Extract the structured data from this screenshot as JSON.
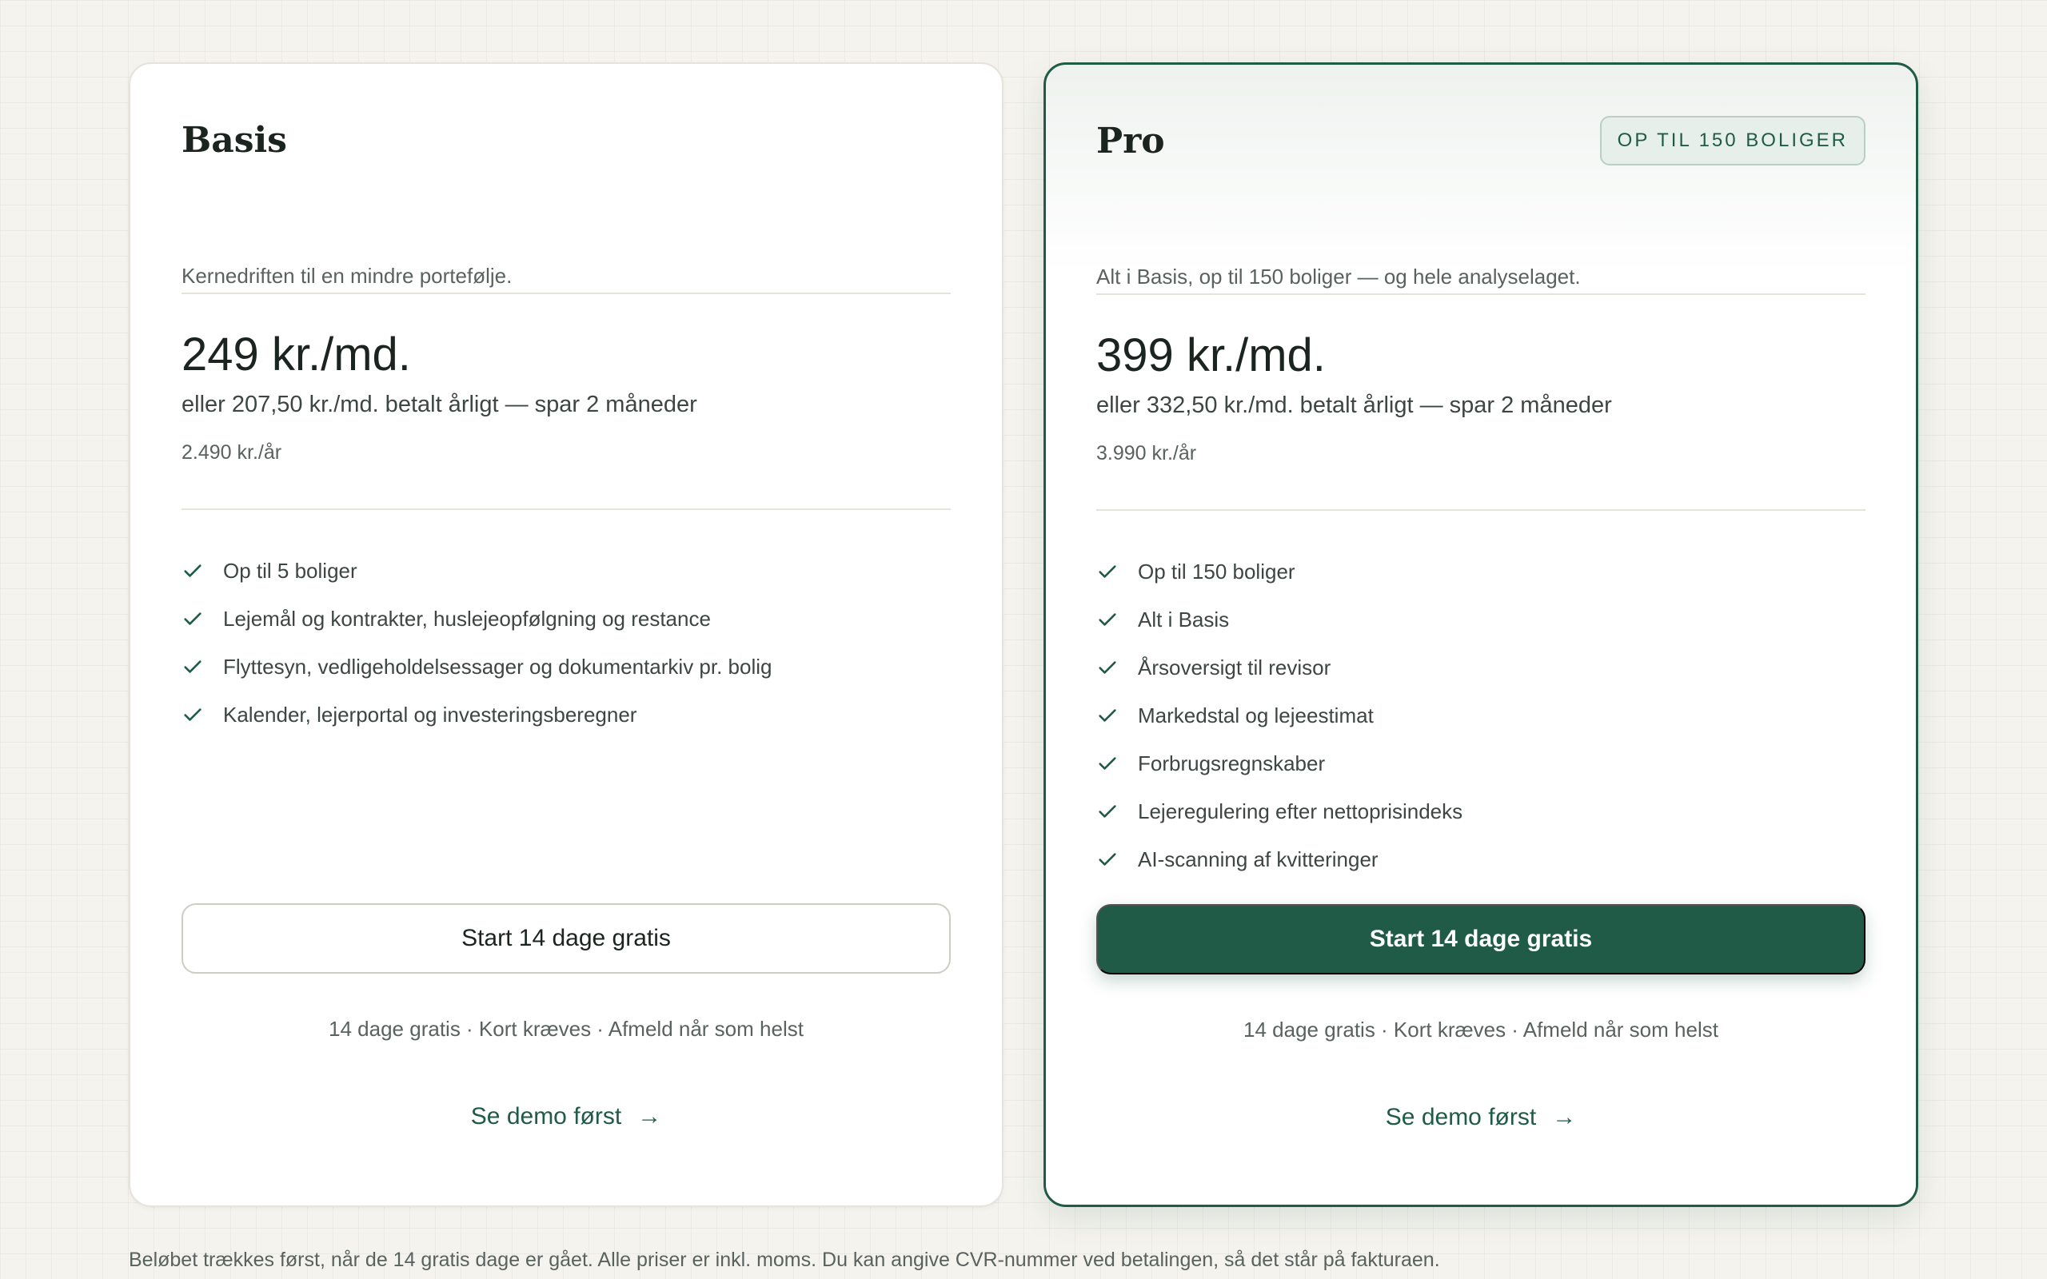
{
  "plans": [
    {
      "name": "Basis",
      "badge": "",
      "description": "Kernedriften til en mindre portefølje.",
      "price": "249 kr./md.",
      "yearly_note": "eller 207,50 kr./md. betalt årligt — spar 2 måneder",
      "per_year": "2.490 kr./år",
      "features": [
        "Op til 5 boliger",
        "Lejemål og kontrakter, huslejeopfølgning og restance",
        "Flyttesyn, vedligeholdelsessager og dokumentarkiv pr. bolig",
        "Kalender, lejerportal og investeringsberegner"
      ],
      "cta_label": "Start 14 dage gratis",
      "fine_print": "14 dage gratis · Kort kræves · Afmeld når som helst",
      "demo_label": "Se demo først",
      "demo_arrow": "→"
    },
    {
      "name": "Pro",
      "badge": "OP TIL 150 BOLIGER",
      "description": "Alt i Basis, op til 150 boliger — og hele analyselaget.",
      "price": "399 kr./md.",
      "yearly_note": "eller 332,50 kr./md. betalt årligt — spar 2 måneder",
      "per_year": "3.990 kr./år",
      "features": [
        "Op til 150 boliger",
        "Alt i Basis",
        "Årsoversigt til revisor",
        "Markedstal og lejeestimat",
        "Forbrugsregnskaber",
        "Lejeregulering efter nettoprisindeks",
        "AI-scanning af kvitteringer"
      ],
      "cta_label": "Start 14 dage gratis",
      "fine_print": "14 dage gratis · Kort kræves · Afmeld når som helst",
      "demo_label": "Se demo først",
      "demo_arrow": "→"
    }
  ],
  "footnote": "Beløbet trækkes først, når de 14 gratis dage er gået. Alle priser er inkl. moms. Du kan angive CVR-nummer ved betalingen, så det står på fakturaen.",
  "icons": {
    "feature": "check-icon"
  },
  "colors": {
    "accent": "#1f5b47",
    "background": "#f5f3ee",
    "badge_bg": "#e6efea"
  }
}
